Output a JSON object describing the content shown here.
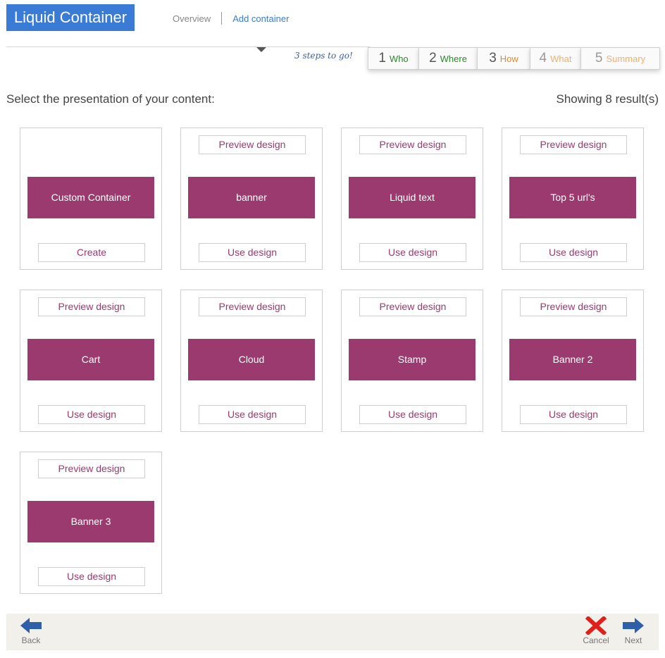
{
  "app": {
    "title": "Liquid Container"
  },
  "breadcrumb": {
    "overview": "Overview",
    "current": "Add container"
  },
  "steps": {
    "remaining": "3 steps to go!",
    "items": [
      {
        "num": "1",
        "label": "Who"
      },
      {
        "num": "2",
        "label": "Where"
      },
      {
        "num": "3",
        "label": "How"
      },
      {
        "num": "4",
        "label": "What"
      },
      {
        "num": "5",
        "label": "Summary"
      }
    ]
  },
  "main": {
    "prompt": "Select the presentation of your content:",
    "results": "Showing 8 result(s)",
    "cards": [
      {
        "name": "Custom Container",
        "action": "Create"
      },
      {
        "name": "banner",
        "preview": "Preview design",
        "action": "Use design"
      },
      {
        "name": "Liquid text",
        "preview": "Preview design",
        "action": "Use design"
      },
      {
        "name": "Top 5 url's",
        "preview": "Preview design",
        "action": "Use design"
      },
      {
        "name": "Cart",
        "preview": "Preview design",
        "action": "Use design"
      },
      {
        "name": "Cloud",
        "preview": "Preview design",
        "action": "Use design"
      },
      {
        "name": "Stamp",
        "preview": "Preview design",
        "action": "Use design"
      },
      {
        "name": "Banner 2",
        "preview": "Preview design",
        "action": "Use design"
      },
      {
        "name": "Banner 3",
        "preview": "Preview design",
        "action": "Use design"
      }
    ]
  },
  "footer": {
    "back": "Back",
    "cancel": "Cancel",
    "next": "Next"
  },
  "colors": {
    "accent": "#9b3a6e",
    "title_bg": "#3a7bd5",
    "cancel_red": "#e0201a",
    "arrow_blue": "#2f5fa8"
  },
  "icons": {
    "back": "arrow-left-icon",
    "cancel": "x-icon",
    "next": "arrow-right-icon"
  }
}
